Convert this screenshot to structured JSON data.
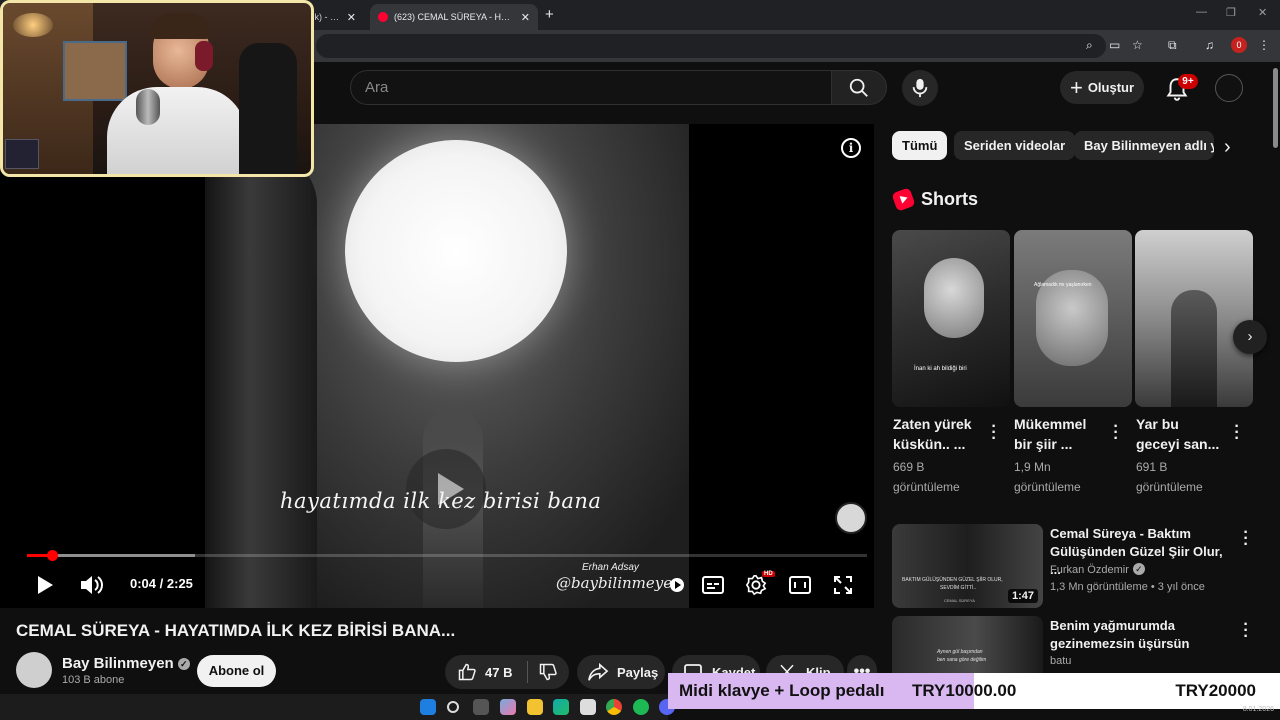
{
  "browser": {
    "tabs": [
      {
        "title": "ltik) - Be",
        "active": false
      },
      {
        "title": "(623) CEMAL SÜREYA - HAYATIMDA",
        "active": true
      }
    ],
    "new_tab": "+",
    "window_controls": [
      "—",
      "❐",
      "✕"
    ],
    "profile_badge": "0"
  },
  "header": {
    "search_placeholder": "Ara",
    "create_label": "Oluştur",
    "notifications_badge": "9+"
  },
  "player": {
    "lyric": "hayatımda ilk kez birisi bana",
    "credit": "Erhan Adsay",
    "watermark": "@baybilinmeyen",
    "time_current": "0:04",
    "time_total": "2:25",
    "progress_fraction": 0.03,
    "buffer_fraction": 0.2
  },
  "video": {
    "title": "CEMAL SÜREYA - HAYATIMDA İLK KEZ BİRİSİ BANA...",
    "channel": "Bay Bilinmeyen",
    "subscribers": "103 B abone",
    "subscribe_label": "Abone ol",
    "likes": "47 B",
    "share_label": "Paylaş",
    "save_label": "Kaydet",
    "clip_label": "Klip"
  },
  "chips": [
    {
      "label": "Tümü",
      "active": true
    },
    {
      "label": "Seriden videolar",
      "active": false
    },
    {
      "label": "Bay Bilinmeyen adlı yü",
      "active": false
    }
  ],
  "shorts": {
    "heading": "Shorts",
    "items": [
      {
        "title_line1": "Zaten yürek",
        "title_line2": "küskün.. ...",
        "views_line1": "669 B",
        "views_line2": "görüntüleme",
        "overlay": "İnan ki ah bildiği biri"
      },
      {
        "title_line1": "Mükemmel",
        "title_line2": "bir şiir ...",
        "views_line1": "1,9 Mn",
        "views_line2": "görüntüleme",
        "overlay": "Ağlamadık mı yaşlanırken"
      },
      {
        "title_line1": "Yar bu",
        "title_line2": "geceyi san...",
        "views_line1": "691 B",
        "views_line2": "görüntüleme",
        "overlay": ""
      }
    ]
  },
  "related": [
    {
      "title_line1": "Cemal Süreya - Baktım",
      "title_line2": "Gülüşünden Güzel Şiir Olur, ...",
      "channel": "Furkan Özdemir",
      "meta": "1,3 Mn görüntüleme • 3 yıl önce",
      "duration": "1:47",
      "thumb_caption1": "BAKTIM GÜLÜŞÜNDEN GÜZEL ŞİİR OLUR,",
      "thumb_caption2": "SEVDİM GİTTİ..",
      "thumb_caption3": "CEMAL SÜREYA"
    },
    {
      "title_line1": "Benim yağmurumda",
      "title_line2": "gezinemezsin üşürsün",
      "channel": "batu",
      "meta": "",
      "duration": "",
      "thumb_caption1": "Aynen gül başımdan",
      "thumb_caption2": "ben sana göre değilim",
      "thumb_caption3": ""
    }
  ],
  "donation": {
    "label": "Midi klavye + Loop pedalı",
    "current": "TRY10000.00",
    "goal": "TRY20000",
    "progress_fraction": 0.5
  },
  "system": {
    "date": "8.01.2026"
  }
}
